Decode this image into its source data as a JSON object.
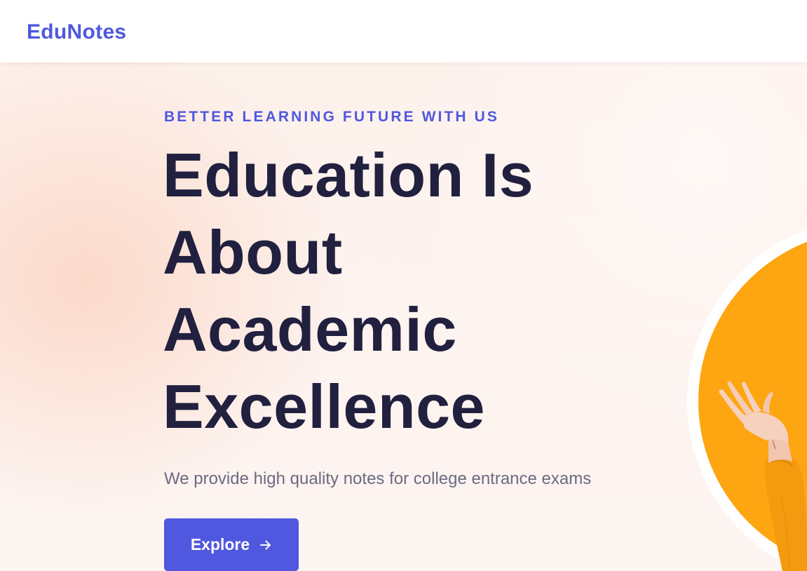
{
  "header": {
    "logo": "EduNotes"
  },
  "hero": {
    "eyebrow": "BETTER LEARNING FUTURE WITH US",
    "headline_lines": [
      "Education Is",
      "About",
      "Academic",
      "Excellence"
    ],
    "subtitle": "We provide high quality notes for college entrance exams",
    "cta_label": "Explore",
    "cta_icon": "arrow-right-icon"
  },
  "colors": {
    "brand": "#5058df",
    "headline": "#21203f",
    "subtitle": "#6b6a80",
    "accent_circle": "#fea512",
    "hero_background": "#fdf3ef"
  }
}
